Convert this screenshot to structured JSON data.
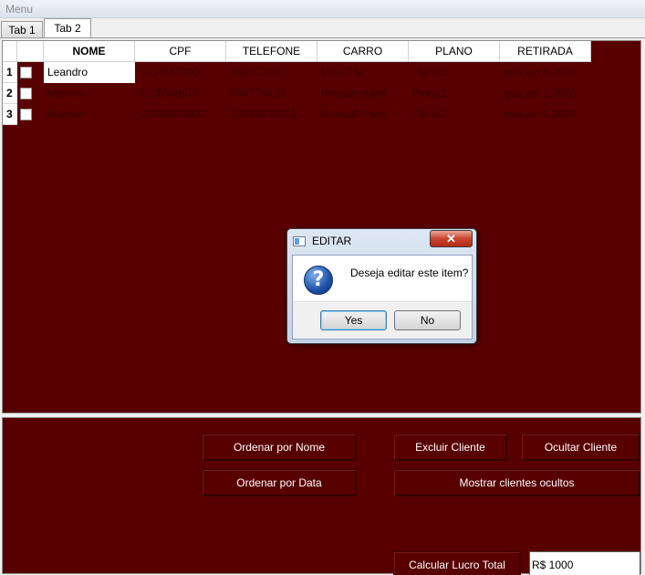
{
  "menu": {
    "label": "Menu"
  },
  "tabs": [
    {
      "label": "Tab 1"
    },
    {
      "label": "Tab 2"
    }
  ],
  "table": {
    "headers": [
      "NOME",
      "CPF",
      "TELEFONE",
      "CARRO",
      "PLANO",
      "RETIRADA"
    ],
    "rows": [
      {
        "num": "1",
        "nome": "Leandro",
        "cpf": "12345678901",
        "telefone": "988371201",
        "carro": "Polo TSI",
        "plano": "Plano1",
        "retirada": "qua jan 1 2020"
      },
      {
        "num": "2",
        "nome": "Marcos",
        "cpf": "3216549870",
        "telefone": "988774410",
        "carro": "Renault Kwid",
        "plano": "Plano2",
        "retirada": "qua jan 1 2020"
      },
      {
        "num": "3",
        "nome": "Marcon",
        "cpf": "12345678902",
        "telefone": "12345678901",
        "carro": "Renault Kwid",
        "plano": "Plano2",
        "retirada": "qua jan 1 2020"
      }
    ]
  },
  "buttons": {
    "ordenar_nome": "Ordenar por Nome",
    "excluir_cliente": "Excluir Cliente",
    "ocultar_cliente": "Ocultar Cliente",
    "ordenar_data": "Ordenar por Data",
    "mostrar_ocultos": "Mostrar clientes ocultos",
    "calcular_lucro": "Calcular Lucro Total"
  },
  "lucro": {
    "value": "R$ 1000"
  },
  "dialog": {
    "title": "EDITAR",
    "message": "Deseja editar este item?",
    "yes": "Yes",
    "no": "No",
    "close": "✕"
  },
  "colors": {
    "panel_bg": "#580000",
    "dialog_accent": "#1c4fa8"
  },
  "icons": {
    "dialog_window": "app-window-icon",
    "question": "question-icon",
    "close": "close-icon"
  }
}
